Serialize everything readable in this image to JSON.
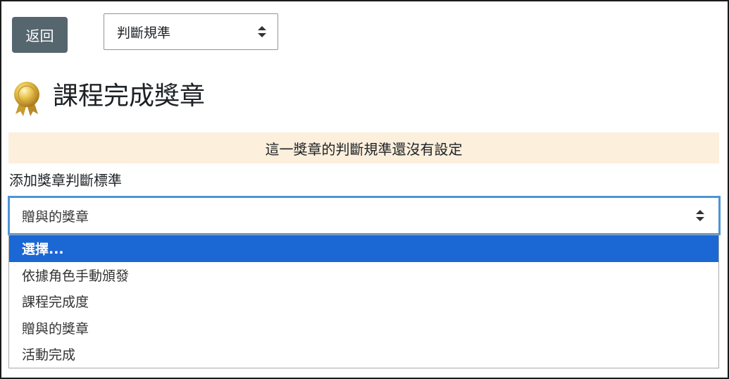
{
  "toolbar": {
    "back_label": "返回",
    "nav_select_value": "判斷規準"
  },
  "header": {
    "title": "課程完成獎章",
    "icon": "award-medal-icon"
  },
  "notice": {
    "text": "這一獎章的判斷規準還沒有設定",
    "background": "#fcefdc"
  },
  "criteria": {
    "label": "添加獎章判斷標準",
    "current_value": "贈與的獎章",
    "options": [
      {
        "label": "選擇...",
        "highlighted": true
      },
      {
        "label": "依據角色手動頒發",
        "highlighted": false
      },
      {
        "label": "課程完成度",
        "highlighted": false
      },
      {
        "label": "贈與的獎章",
        "highlighted": false
      },
      {
        "label": "活動完成",
        "highlighted": false
      }
    ]
  },
  "colors": {
    "back_button": "#56666e",
    "focus_border": "#4c94d6",
    "highlight": "#1b67d4"
  }
}
